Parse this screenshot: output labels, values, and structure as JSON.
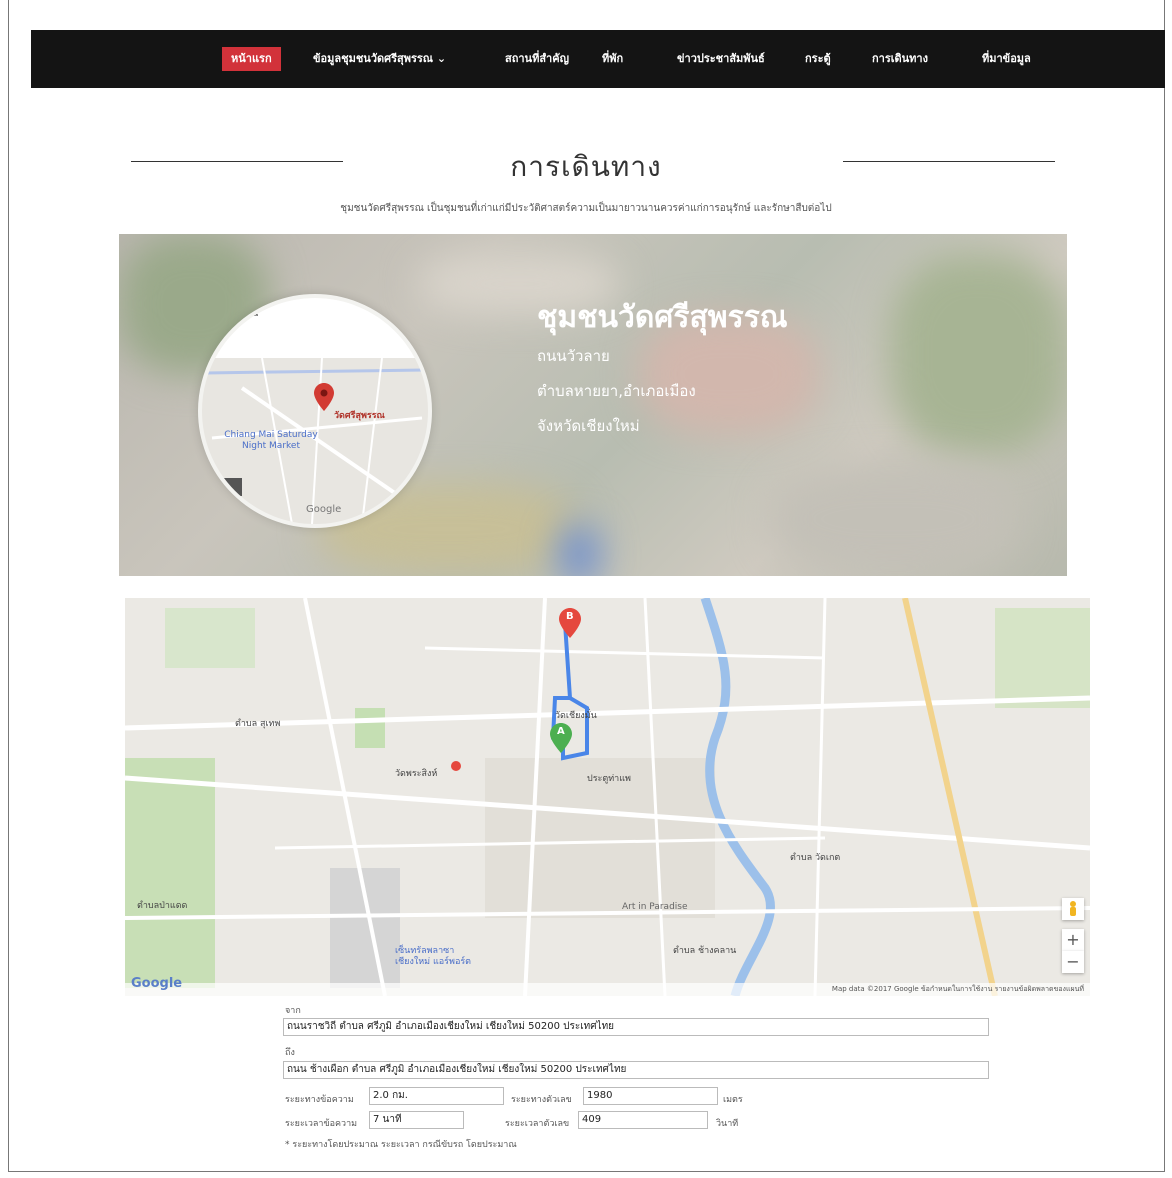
{
  "nav": {
    "items": [
      {
        "label": "หน้าแรก",
        "active": true
      },
      {
        "label": "ข้อมูลชุมชนวัดศรีสุพรรณ ⌄",
        "active": false
      },
      {
        "label": "สถานที่สำคัญ",
        "active": false
      },
      {
        "label": "ที่พัก",
        "active": false
      },
      {
        "label": "ข่าวประชาสัมพันธ์",
        "active": false
      },
      {
        "label": "กระตู้",
        "active": false
      },
      {
        "label": "การเดินทาง",
        "active": false
      },
      {
        "label": "ที่มาข้อมูล",
        "active": false
      }
    ]
  },
  "section": {
    "title": "การเดินทาง",
    "subtitle": "ชุมชนวัดศรีสุพรรณ เป็นชุมชนที่เก่าแก่มีประวัติศาสตร์ความเป็นมายาวนานควรค่าแก่การอนุรักษ์ และรักษาสืบต่อไป"
  },
  "banner": {
    "title": "ชุมชนวัดศรีสุพรรณ",
    "lines": [
      "ถนนวัวลาย",
      "ตำบลหายยา,อำเภอเมือง",
      "จังหวัดเชียงใหม่"
    ],
    "circle_map": {
      "place": "วัดศรีสุพรรณ",
      "market": "Chiang Mai Saturday Night Market",
      "logo": "Google"
    }
  },
  "map": {
    "marker_a": "A",
    "marker_b": "B",
    "labels": {
      "l1": "ตำบล สุเทพ",
      "l2": "ตำบล วัดเกต",
      "l3": "Art in Paradise",
      "l4": "วัดเชียงมั่น",
      "l5": "ประตูท่าแพ",
      "l6": "วัดพระสิงห์",
      "l7": "เซ็นทรัลพลาซา เชียงใหม่ แอร์พอร์ต",
      "l8": "ตำบล ช้างคลาน",
      "l9": "ตำบลป่าแดด"
    },
    "logo": "Google",
    "attribution": "Map data ©2017 Google   ข้อกำหนดในการใช้งาน   รายงานข้อผิดพลาดของแผนที่",
    "zoom_in": "+",
    "zoom_out": "−"
  },
  "form": {
    "from_label": "จาก",
    "from_value": "ถนนราชวิถี ตำบล ศรีภูมิ อำเภอเมืองเชียงใหม่ เชียงใหม่ 50200 ประเทศไทย",
    "to_label": "ถึง",
    "to_value": "ถนน ช้างเผือก ตำบล ศรีภูมิ อำเภอเมืองเชียงใหม่ เชียงใหม่ 50200 ประเทศไทย",
    "dist_text_label": "ระยะทางข้อความ",
    "dist_text_value": "2.0 กม.",
    "dist_num_label": "ระยะทางตัวเลข",
    "dist_num_value": "1980",
    "dist_unit": "เมตร",
    "time_text_label": "ระยะเวลาข้อความ",
    "time_text_value": "7 นาที",
    "time_num_label": "ระยะเวลาตัวเลข",
    "time_num_value": "409",
    "time_unit": "วินาที",
    "note": "* ระยะทางโดยประมาณ ระยะเวลา กรณีขับรถ โดยประมาณ"
  }
}
